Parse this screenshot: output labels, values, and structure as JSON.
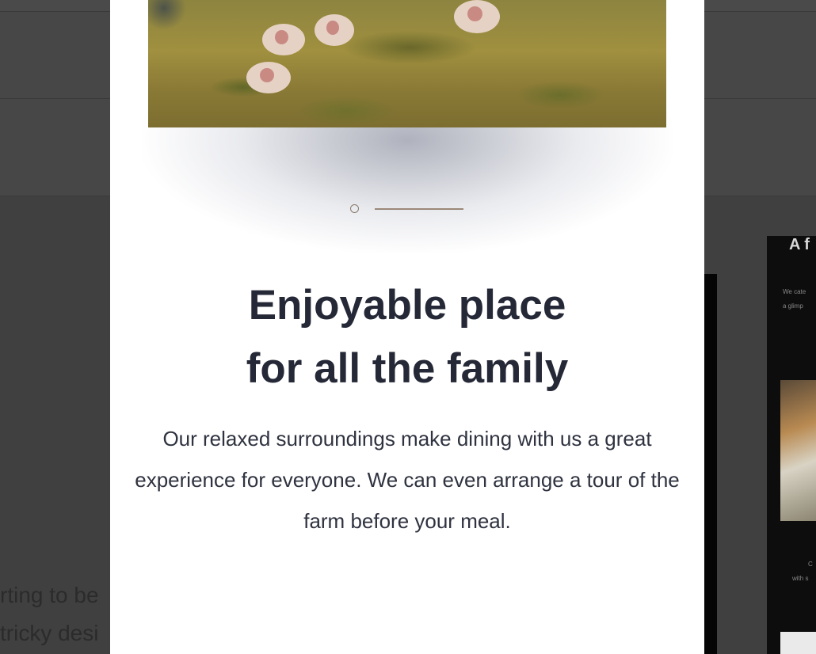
{
  "background": {
    "snippet_lines": [
      "rting to be",
      "tricky desi"
    ],
    "right_panel_title": "A f",
    "right_panel_small_lines": [
      "We cate",
      "a glimp",
      "C",
      "with s"
    ]
  },
  "modal": {
    "image_alt": "Sheep grazing on a grassy hillside",
    "slider": {
      "total_slides": 2,
      "active_index": 0
    },
    "title_line_1": "Enjoyable place",
    "title_line_2": "for all the family",
    "description": "Our relaxed surroundings make dining with us a great experience for everyone. We can even arrange a tour of the farm before your meal."
  },
  "colors": {
    "overlay": "#404040",
    "modal_bg": "#ffffff",
    "title": "#252836",
    "body_text": "#2f3340",
    "accent": "#9a8878"
  }
}
